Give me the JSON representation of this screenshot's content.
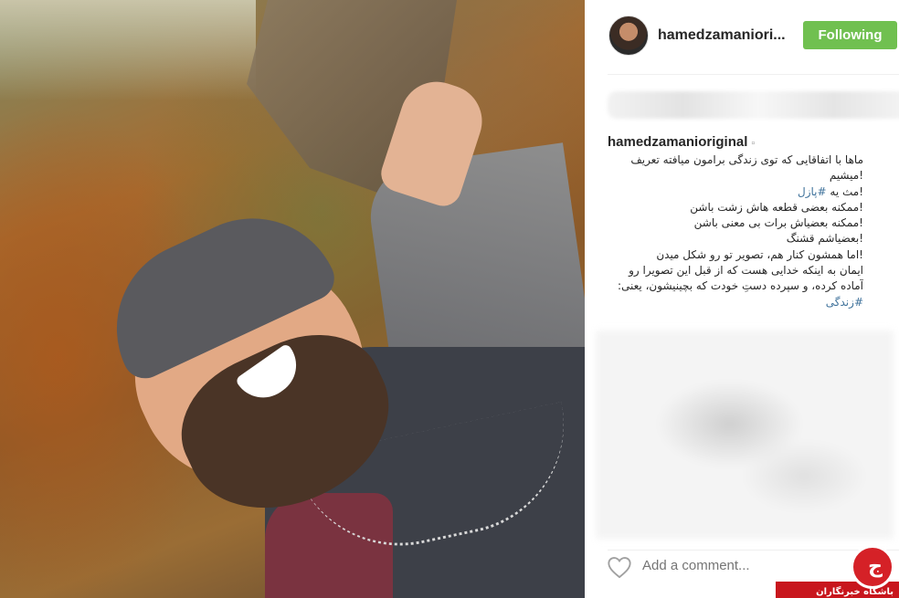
{
  "post": {
    "username": "hamedzamaniori...",
    "follow_label": "Following",
    "colors": {
      "follow": "#70c050",
      "hashtag": "#3f729b"
    }
  },
  "caption": {
    "username": "hamedzamanioriginal",
    "lines": [
      "ماها با اتفاقایی که توی زندگی برامون میافته تعریف",
      "!میشیم",
      "!مث یه",
      "!ممکنه بعضی قطعه هاش زشت باشن",
      "!ممکنه بعضیاش برات بی معنی باشن",
      "!بعضیاشم قشنگ",
      "!اما همشون کنار هم، تصویر تو رو شکل میدن",
      "ایمان به اینکه خدایی هست که از قبل این تصویرا رو",
      "آماده کرده، و سپرده دستِ خودت که بچینیشون، یعنی:"
    ],
    "hashtag_puzzle": "#پازل",
    "hashtag_life": "#زندگی"
  },
  "comment": {
    "placeholder": "Add a comment...",
    "heart_icon": "heart-outline-icon"
  },
  "watermark": {
    "text": "باشگاه خبرنگاران",
    "letter": "ج"
  }
}
